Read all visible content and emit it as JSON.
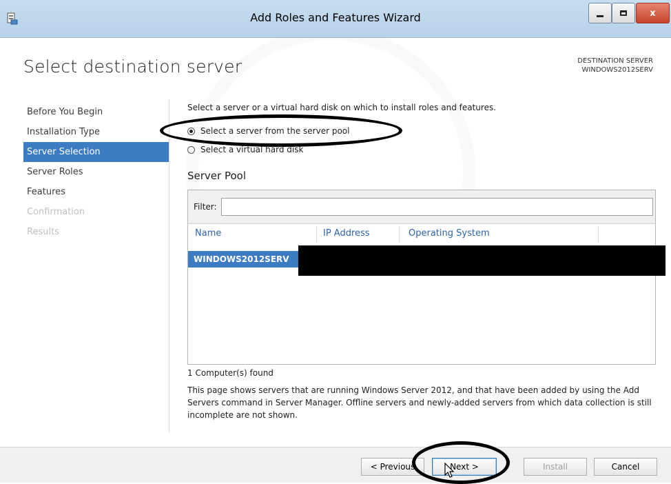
{
  "window": {
    "title": "Add Roles and Features Wizard",
    "controls": {
      "minimize": "minimize",
      "maximize": "maximize",
      "close": "x"
    }
  },
  "header": {
    "page_title": "Select destination server",
    "destination_label": "DESTINATION SERVER",
    "destination_value": "WINDOWS2012SERV"
  },
  "nav": {
    "items": [
      {
        "label": "Before You Begin",
        "state": "normal"
      },
      {
        "label": "Installation Type",
        "state": "normal"
      },
      {
        "label": "Server Selection",
        "state": "active"
      },
      {
        "label": "Server Roles",
        "state": "normal"
      },
      {
        "label": "Features",
        "state": "normal"
      },
      {
        "label": "Confirmation",
        "state": "disabled"
      },
      {
        "label": "Results",
        "state": "disabled"
      }
    ]
  },
  "main": {
    "intro": "Select a server or a virtual hard disk on which to install roles and features.",
    "options": [
      {
        "label": "Select a server from the server pool",
        "selected": true
      },
      {
        "label": "Select a virtual hard disk",
        "selected": false
      }
    ],
    "pool_title": "Server Pool",
    "filter_label": "Filter:",
    "filter_value": "",
    "columns": [
      "Name",
      "IP Address",
      "Operating System"
    ],
    "rows": [
      {
        "name": "WINDOWS2012SERV",
        "ip": "",
        "os": ""
      }
    ],
    "found": "1 Computer(s) found",
    "description": "This page shows servers that are running Windows Server 2012, and that have been added by using the Add Servers command in Server Manager. Offline servers and newly-added servers from which data collection is still incomplete are not shown."
  },
  "footer": {
    "previous": "< Previous",
    "next": "Next >",
    "install": "Install",
    "cancel": "Cancel"
  },
  "colors": {
    "titlebar": "#b6d2ea",
    "accent": "#3d7cc3",
    "close_button": "#c7432a"
  }
}
